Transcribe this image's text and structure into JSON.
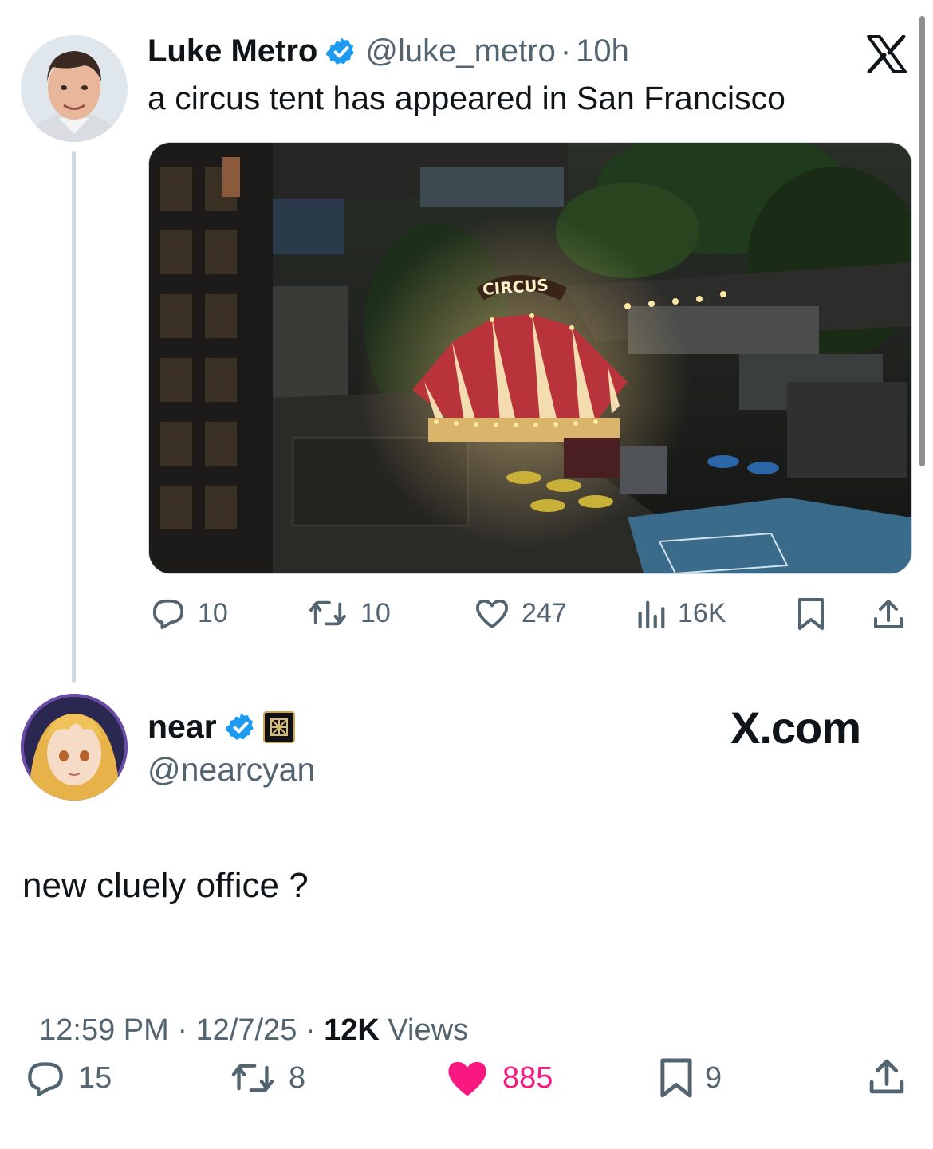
{
  "quoted_tweet": {
    "author_name": "Luke Metro",
    "handle": "@luke_metro",
    "separator": "·",
    "time": "10h",
    "text": "a circus tent has appeared in San Francisco",
    "image_sign": "CIRCUS",
    "actions": {
      "replies": "10",
      "reposts": "10",
      "likes": "247",
      "views": "16K"
    }
  },
  "main_tweet": {
    "author_name": "near",
    "handle": "@nearcyan",
    "brand_label": "X.com",
    "text": "new cluely office ?",
    "timestamp": "12:59 PM · 12/7/25 · ",
    "views_count": "12K",
    "views_label": " Views",
    "actions": {
      "replies": "15",
      "reposts": "8",
      "likes": "885",
      "bookmarks": "9"
    },
    "liked": true
  },
  "colors": {
    "verified_blue": "#1d9bf0",
    "like_pink": "#f91880",
    "muted_gray": "#536471",
    "thread_line": "#cfd9de"
  },
  "icons": [
    "x-logo-icon",
    "verified-badge-icon",
    "affiliate-badge-icon",
    "reply-icon",
    "repost-icon",
    "like-icon",
    "views-icon",
    "bookmark-icon",
    "share-icon"
  ]
}
